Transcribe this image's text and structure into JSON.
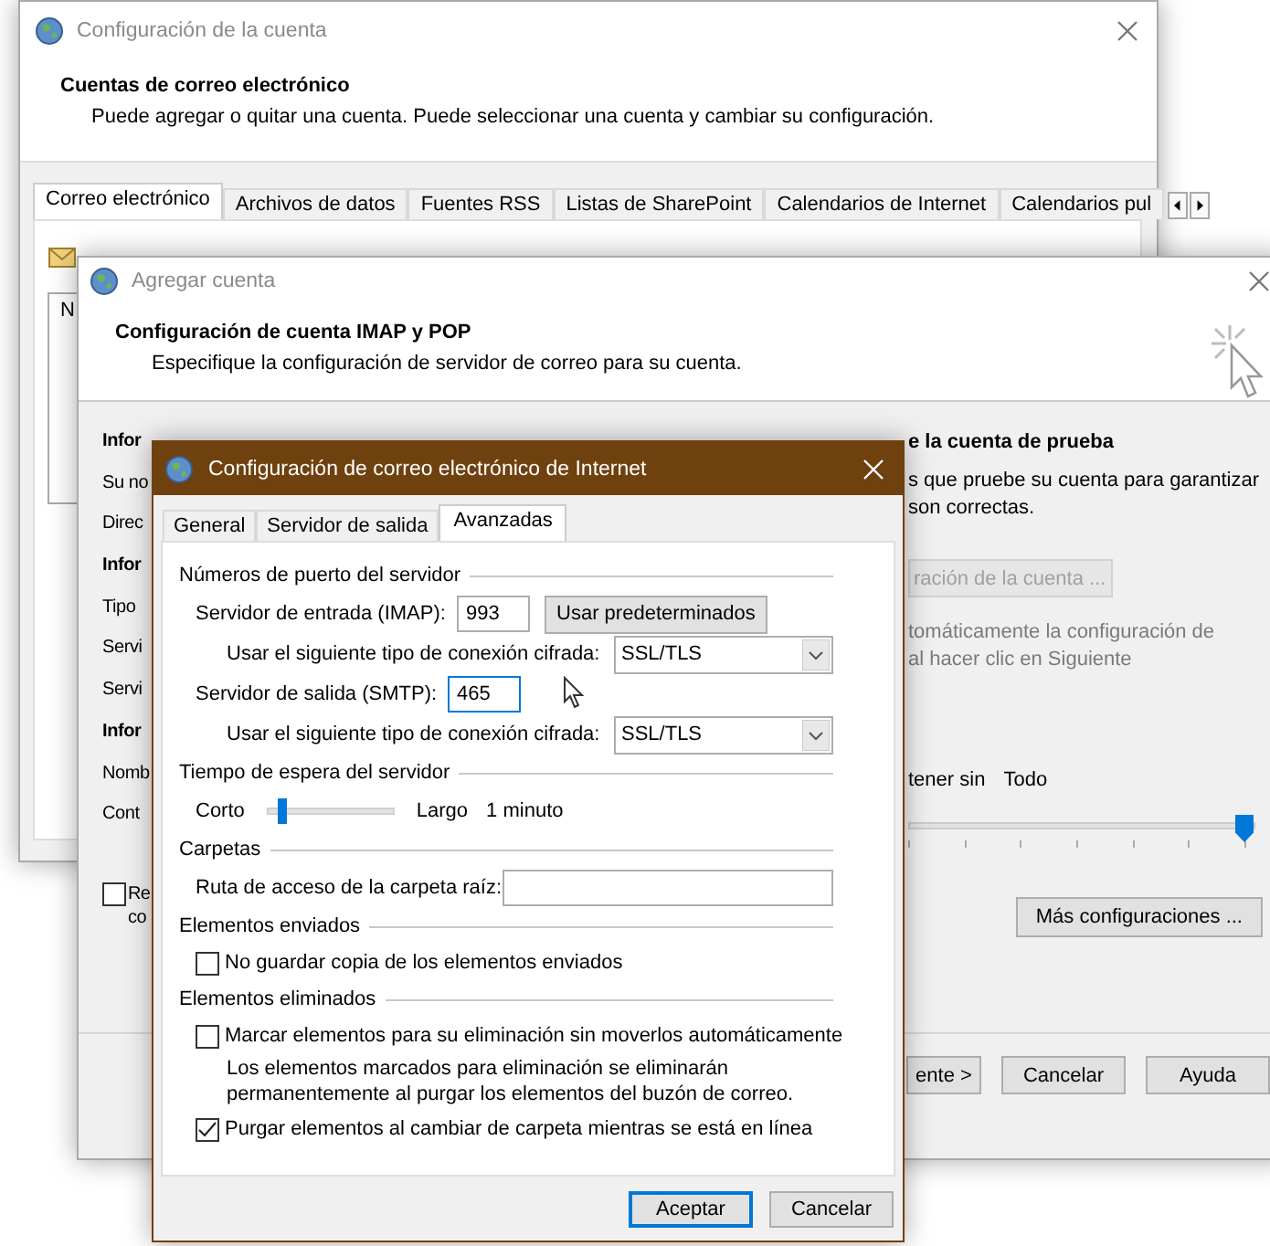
{
  "settings_window": {
    "title": "Configuración de la cuenta",
    "heading": "Cuentas de correo electrónico",
    "description": "Puede agregar o quitar una cuenta. Puede seleccionar una cuenta y cambiar su configuración.",
    "tabs": [
      {
        "label": "Correo electrónico",
        "selected": true
      },
      {
        "label": "Archivos de datos",
        "selected": false
      },
      {
        "label": "Fuentes RSS",
        "selected": false
      },
      {
        "label": "Listas de SharePoint",
        "selected": false
      },
      {
        "label": "Calendarios de Internet",
        "selected": false
      },
      {
        "label": "Calendarios pul",
        "selected": false
      }
    ],
    "list_header": "N"
  },
  "add_account_window": {
    "title": "Agregar cuenta",
    "heading": "Configuración de cuenta IMAP y POP",
    "description": "Especifique la configuración de servidor de correo para su cuenta.",
    "left_labels": [
      {
        "text": "Infor",
        "kind": "heading"
      },
      {
        "text": "Su no",
        "kind": "label"
      },
      {
        "text": "Direc",
        "kind": "label"
      },
      {
        "text": "Infor",
        "kind": "heading"
      },
      {
        "text": "Tipo",
        "kind": "label"
      },
      {
        "text": "Servi",
        "kind": "label"
      },
      {
        "text": "Servi",
        "kind": "label"
      },
      {
        "text": "Infor",
        "kind": "heading"
      },
      {
        "text": "Nomb",
        "kind": "label"
      },
      {
        "text": "Cont",
        "kind": "label"
      }
    ],
    "remember": {
      "label": "Re co",
      "checked": false
    },
    "test_heading": "e la cuenta de prueba",
    "test_text": [
      "s que pruebe su cuenta para garantizar",
      "son correctas."
    ],
    "test_button": {
      "label": "ración de la cuenta ...",
      "disabled": true
    },
    "auto_text": [
      "tomáticamente la configuración de",
      "al hacer clic en Siguiente"
    ],
    "keep_label": "tener sin",
    "keep_value": "Todo",
    "keep_slider": {
      "level": 1
    },
    "more_button": "Más configuraciones ...",
    "buttons": [
      "ente >",
      "Cancelar",
      "Ayuda"
    ]
  },
  "internet_window": {
    "title": "Configuración de correo electrónico de Internet",
    "tabs": [
      {
        "label": "General",
        "selected": false
      },
      {
        "label": "Servidor de salida",
        "selected": false
      },
      {
        "label": "Avanzadas",
        "selected": true
      }
    ],
    "groups": [
      {
        "title": "Números de puerto del servidor",
        "rows": [
          {
            "kind": "port",
            "label": "Servidor de entrada (IMAP):",
            "value": "993",
            "focused": false,
            "button": "Usar predeterminados"
          },
          {
            "kind": "select",
            "label": "Usar el siguiente tipo de conexión cifrada:",
            "value": "SSL/TLS"
          },
          {
            "kind": "port",
            "label": "Servidor de salida (SMTP):",
            "value": "465",
            "focused": true
          },
          {
            "kind": "select",
            "label": "Usar el siguiente tipo de conexión cifrada:",
            "value": "SSL/TLS"
          }
        ]
      },
      {
        "title": "Tiempo de espera del servidor",
        "rows": [
          {
            "kind": "slider",
            "min_label": "Corto",
            "max_label": "Largo",
            "reading": "1 minuto",
            "level": 0.1
          }
        ]
      },
      {
        "title": "Carpetas",
        "rows": [
          {
            "kind": "text",
            "label": "Ruta de acceso de la carpeta raíz:"
          }
        ]
      },
      {
        "title": "Elementos enviados",
        "rows": [
          {
            "kind": "checkbox",
            "label": "No guardar copia de los elementos enviados",
            "checked": false
          }
        ]
      },
      {
        "title": "Elementos eliminados",
        "rows": [
          {
            "kind": "checkbox",
            "label": "Marcar elementos para su eliminación sin moverlos automáticamente",
            "checked": false
          },
          {
            "kind": "note",
            "text": "Los elementos marcados para eliminación se eliminarán permanentemente al purgar los elementos del buzón de correo."
          },
          {
            "kind": "checkbox",
            "label": "Purgar elementos al cambiar de carpeta mientras se está en línea",
            "checked": true
          }
        ]
      }
    ],
    "buttons": [
      {
        "label": "Aceptar",
        "default": true
      },
      {
        "label": "Cancelar",
        "default": false
      }
    ]
  }
}
